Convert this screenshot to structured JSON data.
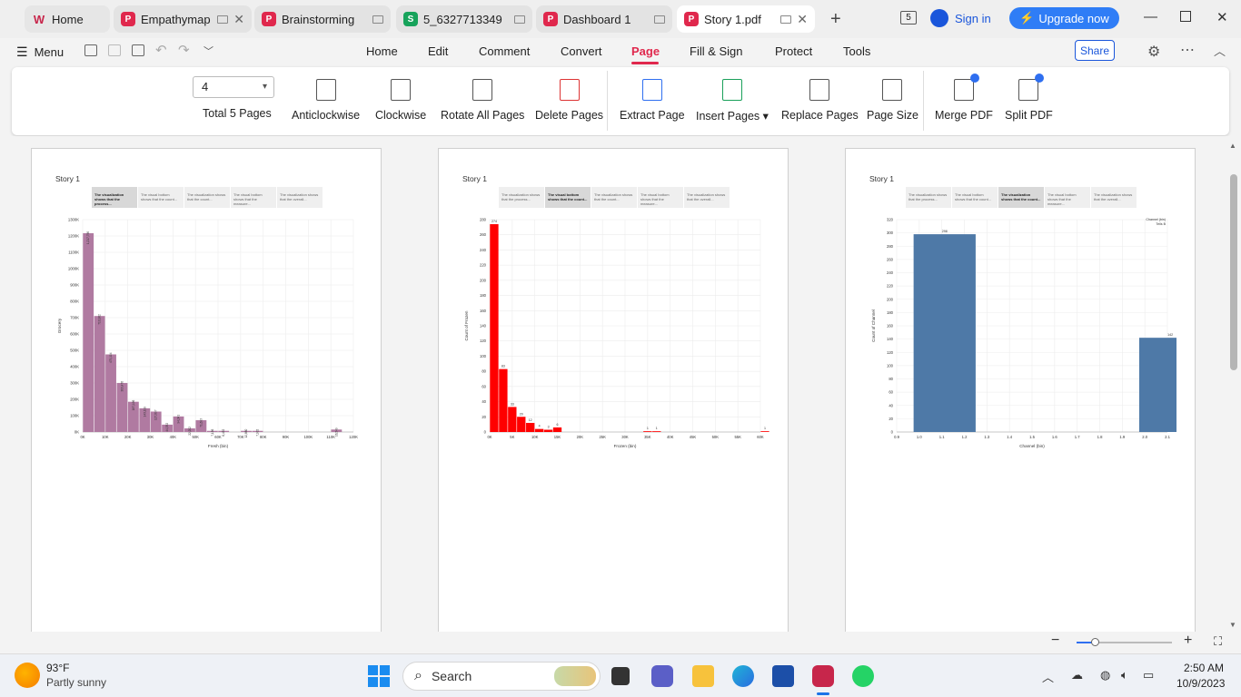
{
  "tabs": [
    {
      "label": "Home",
      "icon": "wps-home-icon",
      "color": "#e0284d",
      "active": false
    },
    {
      "label": "Empathymap",
      "icon": "pdf-icon",
      "color": "#e0284d",
      "active": false
    },
    {
      "label": "Brainstorming",
      "icon": "pdf-icon",
      "color": "#e0284d",
      "active": false
    },
    {
      "label": "5_6327713349",
      "icon": "sheet-icon",
      "color": "#17a35b",
      "active": false
    },
    {
      "label": "Dashboard 1",
      "icon": "pdf-icon",
      "color": "#e0284d",
      "active": false
    },
    {
      "label": "Story 1.pdf",
      "icon": "pdf-icon",
      "color": "#e0284d",
      "active": true
    }
  ],
  "header": {
    "tab_count_badge": "5",
    "sign_in": "Sign in",
    "upgrade": "Upgrade now"
  },
  "menubar": {
    "menu": "Menu",
    "items": [
      "Home",
      "Edit",
      "Comment",
      "Convert",
      "Page",
      "Fill & Sign",
      "Protect",
      "Tools"
    ],
    "active": "Page",
    "share": "Share"
  },
  "ribbon": {
    "page_number": "4",
    "total_pages": "Total 5 Pages",
    "buttons": [
      "Anticlockwise",
      "Clockwise",
      "Rotate All Pages",
      "Delete Pages",
      "Extract Page",
      "Insert Pages",
      "Replace Pages",
      "Page Size",
      "Merge PDF",
      "Split PDF"
    ]
  },
  "pages": [
    {
      "story": "Story 1",
      "tabs": [
        "The visualization shows that the process...",
        "The visual bottom shows that the count...",
        "The visualization shows that the count...",
        "The visual bottom shows that the measure...",
        "The visualization shows that the overall..."
      ],
      "selected_tab": 0
    },
    {
      "story": "Story 1",
      "tabs": [
        "The visualization shows that the process...",
        "The visual bottom shows that the count...",
        "The visualization shows that the count...",
        "The visual bottom shows that the measure...",
        "The visualization shows that the overall..."
      ],
      "selected_tab": 1
    },
    {
      "story": "Story 1",
      "tabs": [
        "The visualization shows that the process...",
        "The visual bottom shows that the count...",
        "The visualization shows that the count...",
        "The visual bottom shows that the measure...",
        "The visualization shows that the overall..."
      ],
      "selected_tab": 2
    }
  ],
  "chart_data": [
    {
      "type": "bar",
      "color": "#b07aa1",
      "xlabel": "Fresh (bin)",
      "ylabel": "Grocery",
      "x_ticks": [
        "0K",
        "10K",
        "20K",
        "30K",
        "40K",
        "50K",
        "60K",
        "70K",
        "80K",
        "90K",
        "100K",
        "110K",
        "120K"
      ],
      "y_ticks": [
        "0K",
        "100K",
        "200K",
        "300K",
        "400K",
        "500K",
        "600K",
        "700K",
        "800K",
        "900K",
        "1000K",
        "1100K",
        "1200K",
        "1300K"
      ],
      "ylim": [
        0,
        1300000
      ],
      "bins_x": [
        0,
        5000,
        10000,
        15000,
        20000,
        25000,
        30000,
        35000,
        40000,
        45000,
        50000,
        55000,
        60000,
        70000,
        75000,
        110000
      ],
      "bin_width": 5000,
      "values": [
        1217000,
        710000,
        475000,
        300000,
        185000,
        145000,
        125000,
        45000,
        95000,
        22000,
        72000,
        7000,
        7000,
        7000,
        7000,
        15000
      ],
      "labels": [
        "1,217,796",
        "710,962",
        "475,104",
        "303,476",
        "187,196",
        "143,199",
        "127,897",
        "44,532",
        "94,041",
        "22,202",
        "71,693",
        "7,156",
        "6,452",
        "12,880",
        "7,932",
        "16,549"
      ]
    },
    {
      "type": "bar",
      "color": "#ff0000",
      "xlabel": "Frozen (bin)",
      "ylabel": "Count of Frozen",
      "x_ticks": [
        "0K",
        "5K",
        "10K",
        "15K",
        "20K",
        "25K",
        "30K",
        "35K",
        "40K",
        "45K",
        "50K",
        "55K",
        "60K"
      ],
      "y_ticks": [
        "0",
        "20",
        "40",
        "60",
        "80",
        "100",
        "120",
        "140",
        "160",
        "180",
        "200",
        "220",
        "240",
        "260",
        "280"
      ],
      "ylim": [
        0,
        280
      ],
      "bins_x": [
        0,
        2000,
        4000,
        6000,
        8000,
        10000,
        12000,
        14000,
        16000,
        34000,
        36000,
        60000
      ],
      "bin_width": 2000,
      "values": [
        274,
        83,
        33,
        20,
        12,
        4,
        3,
        6,
        0,
        1,
        1,
        1
      ],
      "labels": [
        "274",
        "83",
        "33",
        "20",
        "12",
        "4",
        "3",
        "6",
        "",
        "1",
        "1",
        "1"
      ]
    },
    {
      "type": "bar",
      "color": "#4e79a7",
      "xlabel": "Channel (bin)",
      "ylabel": "Count of Channel",
      "legend": [
        "Channel (bin)",
        "Tells B"
      ],
      "x_ticks": [
        "0.9",
        "1.0",
        "1.1",
        "1.2",
        "1.3",
        "1.4",
        "1.5",
        "1.6",
        "1.7",
        "1.8",
        "1.9",
        "2.0",
        "2.1"
      ],
      "y_ticks": [
        "0",
        "20",
        "40",
        "60",
        "80",
        "100",
        "120",
        "140",
        "160",
        "180",
        "200",
        "220",
        "240",
        "260",
        "280",
        "300",
        "320"
      ],
      "ylim": [
        0,
        320
      ],
      "categories": [
        "1.0",
        "2.0"
      ],
      "values": [
        298,
        142
      ],
      "labels": [
        "298",
        "142"
      ]
    }
  ],
  "zoom": {
    "level_fraction": 0.2
  },
  "taskbar": {
    "weather_temp": "93°F",
    "weather_desc": "Partly sunny",
    "search_placeholder": "Search",
    "time": "2:50 AM",
    "date": "10/9/2023"
  }
}
